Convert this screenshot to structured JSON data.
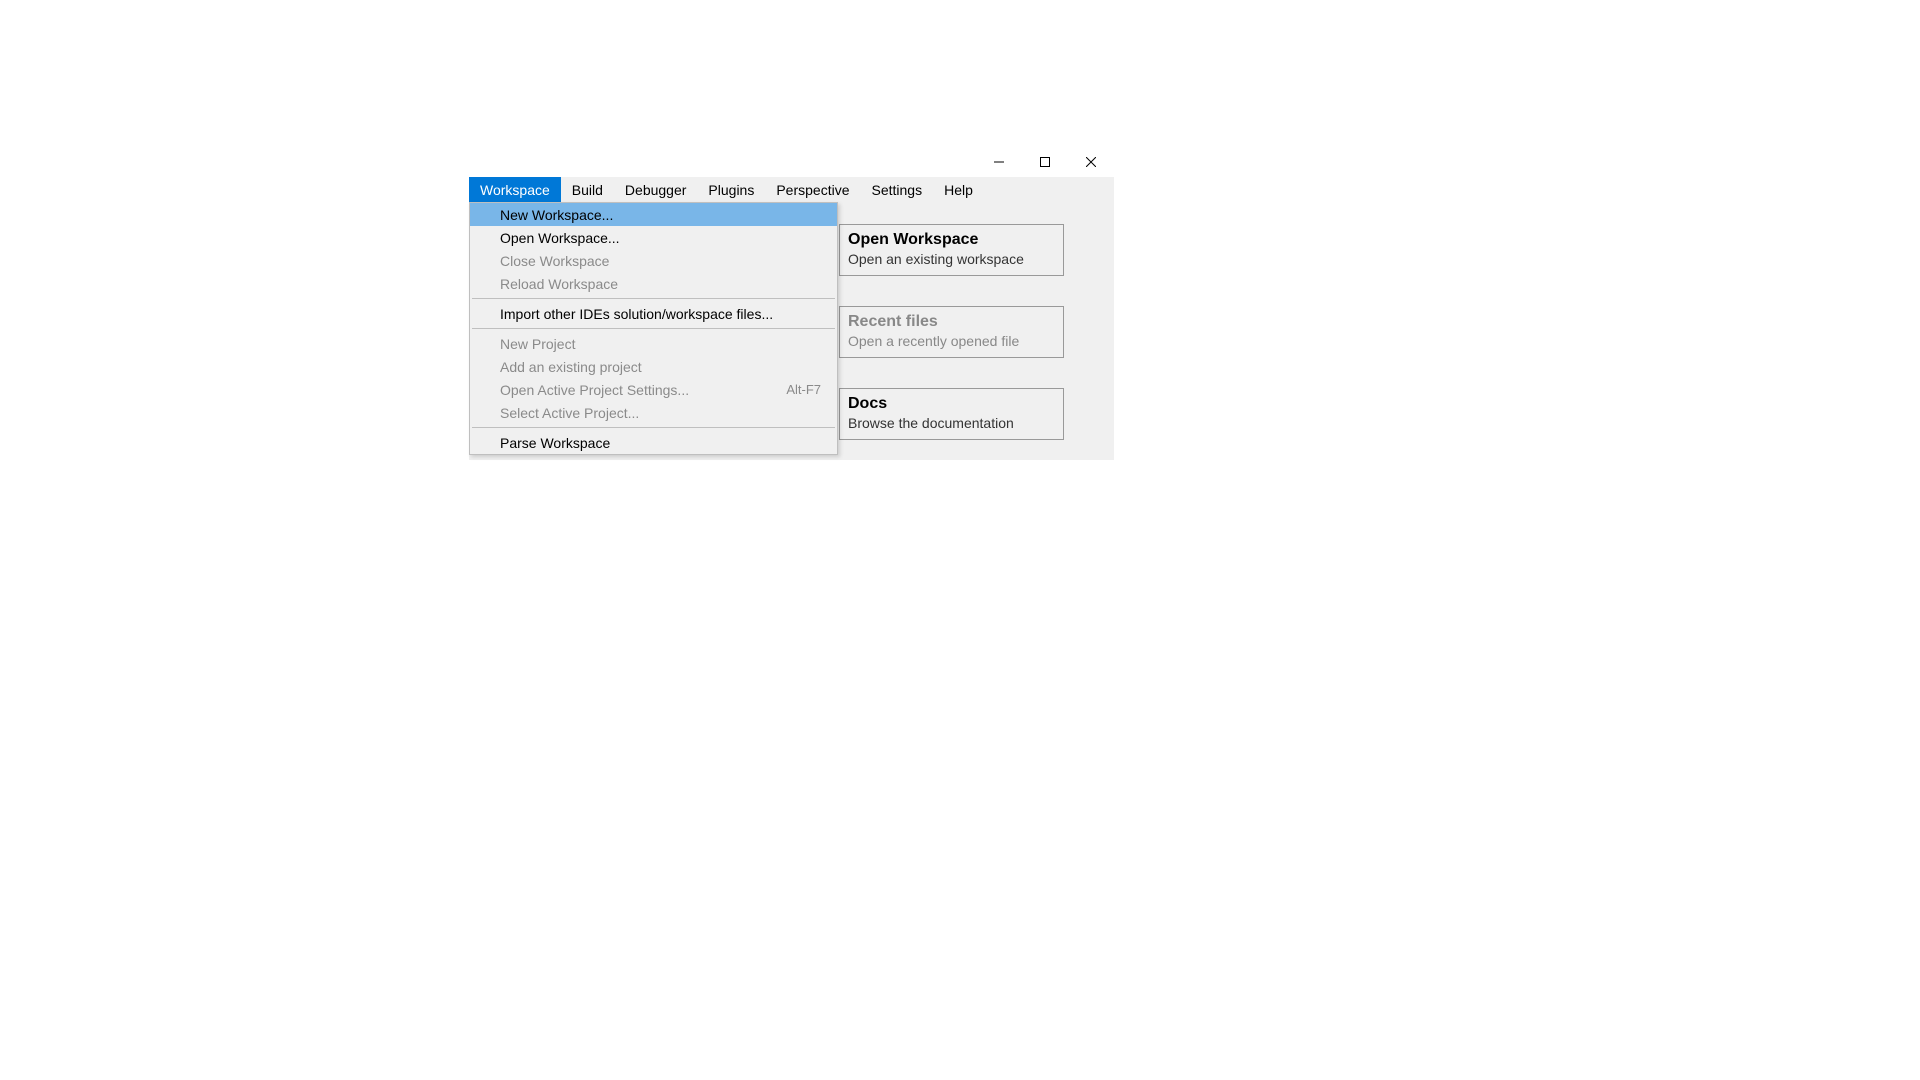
{
  "window": {
    "controls": {
      "minimize": "minimize",
      "maximize": "maximize",
      "close": "close"
    }
  },
  "menubar": {
    "items": [
      "Workspace",
      "Build",
      "Debugger",
      "Plugins",
      "Perspective",
      "Settings",
      "Help"
    ],
    "active_index": 0
  },
  "dropdown": {
    "groups": [
      [
        {
          "label": "New Workspace...",
          "enabled": true,
          "selected": true,
          "shortcut": ""
        },
        {
          "label": "Open Workspace...",
          "enabled": true,
          "selected": false,
          "shortcut": ""
        },
        {
          "label": "Close Workspace",
          "enabled": false,
          "selected": false,
          "shortcut": ""
        },
        {
          "label": "Reload Workspace",
          "enabled": false,
          "selected": false,
          "shortcut": ""
        }
      ],
      [
        {
          "label": "Import other IDEs solution/workspace files...",
          "enabled": true,
          "selected": false,
          "shortcut": ""
        }
      ],
      [
        {
          "label": "New Project",
          "enabled": false,
          "selected": false,
          "shortcut": ""
        },
        {
          "label": "Add an existing project",
          "enabled": false,
          "selected": false,
          "shortcut": ""
        },
        {
          "label": "Open Active Project Settings...",
          "enabled": false,
          "selected": false,
          "shortcut": "Alt-F7"
        },
        {
          "label": "Select Active Project...",
          "enabled": false,
          "selected": false,
          "shortcut": ""
        }
      ],
      [
        {
          "label": "Parse Workspace",
          "enabled": true,
          "selected": false,
          "shortcut": ""
        }
      ]
    ]
  },
  "cards": [
    {
      "title": "Open Workspace",
      "subtitle": "Open an existing workspace",
      "dim": false
    },
    {
      "title": "Recent files",
      "subtitle": "Open a recently opened file",
      "dim": true
    },
    {
      "title": "Docs",
      "subtitle": "Browse the documentation",
      "dim": false
    }
  ]
}
